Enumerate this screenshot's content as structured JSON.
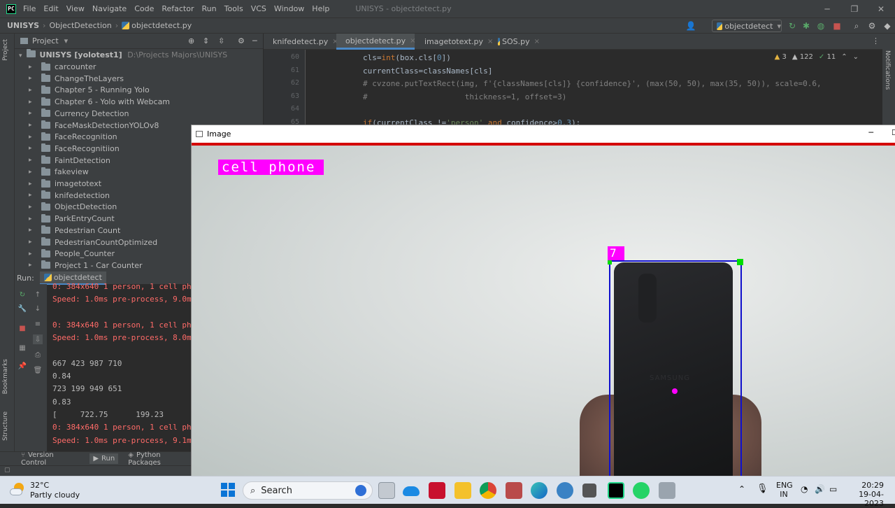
{
  "window_title": "UNISYS - objectdetect.py",
  "menu": [
    "File",
    "Edit",
    "View",
    "Navigate",
    "Code",
    "Refactor",
    "Run",
    "Tools",
    "VCS",
    "Window",
    "Help"
  ],
  "breadcrumbs": {
    "project": "UNISYS",
    "folder": "ObjectDetection",
    "file": "objectdetect.py"
  },
  "run_config": "objectdetect",
  "project_panel": {
    "title": "Project",
    "root_name": "UNISYS [yolotest1]",
    "root_path": "D:\\Projects Majors\\UNISYS",
    "items": [
      "carcounter",
      "ChangeTheLayers",
      "Chapter 5 - Running Yolo",
      "Chapter 6 - Yolo with Webcam",
      "Currency Detection",
      "FaceMaskDetectionYOLOv8",
      "FaceRecognition",
      "FaceRecognitiion",
      "FaintDetection",
      "fakeview",
      "imagetotext",
      "knifedetection",
      "ObjectDetection",
      "ParkEntryCount",
      "Pedestrian Count",
      "PedestrianCountOptimized",
      "People_Counter",
      "Project 1 - Car Counter"
    ]
  },
  "tabs": [
    "knifedetect.py",
    "objectdetect.py",
    "imagetotext.py",
    "SOS.py"
  ],
  "active_tab": "objectdetect.py",
  "inspections": {
    "warnings": "3",
    "weak": "122",
    "ok": "11"
  },
  "code_lines": [
    {
      "n": "60",
      "text": "cls=int(box.cls[0])"
    },
    {
      "n": "61",
      "text": "currentClass=classNames[cls]"
    },
    {
      "n": "62",
      "text": "# cvzone.putTextRect(img, f'{classNames[cls]} {confidence}', (max(50, 50), max(35, 50)), scale=0.6,"
    },
    {
      "n": "63",
      "text": "#                     thickness=1, offset=3)"
    },
    {
      "n": "64",
      "text": ""
    },
    {
      "n": "65",
      "text": "if(currentClass !='person' and confidence>0.3):"
    }
  ],
  "run_panel": {
    "label": "Run:",
    "tab": "objectdetect",
    "output": [
      {
        "t": "0: 384x640 1 person, 1 cell ph",
        "c": "red"
      },
      {
        "t": "Speed: 1.0ms pre-process, 9.0m",
        "c": "red"
      },
      {
        "t": "",
        "c": "plain"
      },
      {
        "t": "0: 384x640 1 person, 1 cell ph",
        "c": "red"
      },
      {
        "t": "Speed: 1.0ms pre-process, 8.0m",
        "c": "red"
      },
      {
        "t": "",
        "c": "plain"
      },
      {
        "t": "667 423 987 710",
        "c": "plain"
      },
      {
        "t": "0.84",
        "c": "plain"
      },
      {
        "t": "723 199 949 651",
        "c": "plain"
      },
      {
        "t": "0.83",
        "c": "plain"
      },
      {
        "t": "[     722.75      199.23",
        "c": "plain"
      },
      {
        "t": "0: 384x640 1 person, 1 cell ph",
        "c": "red"
      },
      {
        "t": "Speed: 1.0ms pre-process, 9.1m",
        "c": "red"
      }
    ]
  },
  "bottom_tabs": [
    "Version Control",
    "Run",
    "Python Packages"
  ],
  "side_labels": {
    "project": "Project",
    "bookmarks": "Bookmarks",
    "structure": "Structure",
    "notifications": "Notifications"
  },
  "image_window": {
    "title": "Image",
    "detection_label": "cell phone",
    "track_id": "7",
    "phone_brand": "SAMSUNG"
  },
  "taskbar": {
    "weather_temp": "32°C",
    "weather_desc": "Partly cloudy",
    "search_placeholder": "Search",
    "lang_top": "ENG",
    "lang_bottom": "IN",
    "time": "20:29",
    "date": "19-04-2023"
  },
  "colors": {
    "detection_box": "#ff00ff",
    "bbox_border": "#1010cc",
    "accent_green": "#00dd00"
  }
}
